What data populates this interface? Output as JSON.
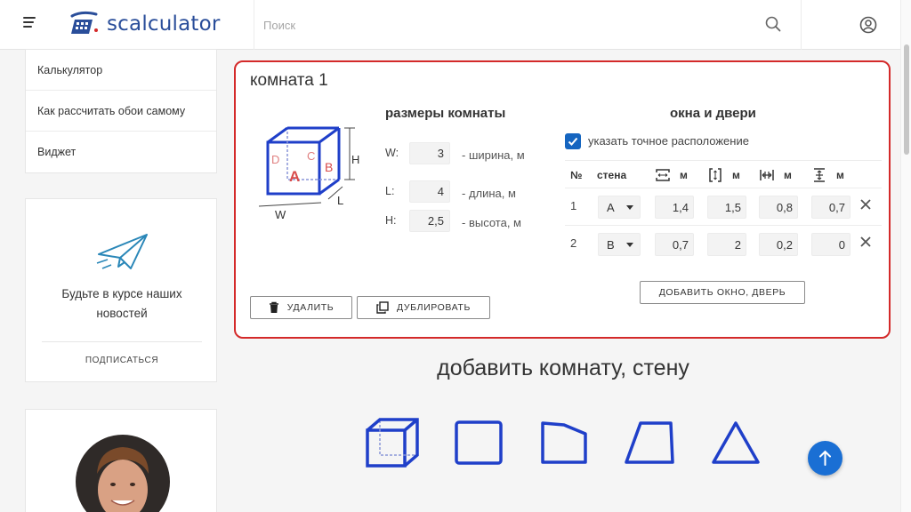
{
  "header": {
    "logo_text": "scalculator",
    "search_placeholder": "Поиск"
  },
  "sidebar": {
    "nav": [
      {
        "label": "Калькулятор"
      },
      {
        "label": "Как рассчитать обои самому"
      },
      {
        "label": "Виджет"
      }
    ],
    "news": {
      "text": "Будьте в курсе наших новостей",
      "subscribe": "ПОДПИСАТЬСЯ"
    }
  },
  "room": {
    "title": "комната 1",
    "diagram": {
      "wall_a": "A",
      "wall_b": "B",
      "wall_c": "C",
      "wall_d": "D",
      "w": "W",
      "l": "L",
      "h": "H"
    },
    "dims_title": "размеры комнаты",
    "dims": [
      {
        "label": "W:",
        "value": "3",
        "desc": "- ширина, м"
      },
      {
        "label": "L:",
        "value": "4",
        "desc": "- длина, м"
      },
      {
        "label": "H:",
        "value": "2,5",
        "desc": "- высота, м"
      }
    ],
    "openings_title": "окна и двери",
    "exact_label": "указать точное расположение",
    "exact_checked": true,
    "headers": {
      "no": "№",
      "wall": "стена",
      "unit": "м"
    },
    "openings": [
      {
        "no": "1",
        "wall": "A",
        "width": "1,4",
        "height": "1,5",
        "offset": "0,8",
        "bottom": "0,7"
      },
      {
        "no": "2",
        "wall": "B",
        "width": "0,7",
        "height": "2",
        "offset": "0,2",
        "bottom": "0"
      }
    ],
    "add_opening": "ДОБАВИТЬ ОКНО, ДВЕРЬ",
    "delete": "УДАЛИТЬ",
    "duplicate": "ДУБЛИРОВАТЬ"
  },
  "add_section": {
    "title": "добавить комнату, стену"
  },
  "colors": {
    "accent": "#1a6fd4",
    "shape_blue": "#1f3fc9",
    "highlight_red": "#d42a2a"
  }
}
